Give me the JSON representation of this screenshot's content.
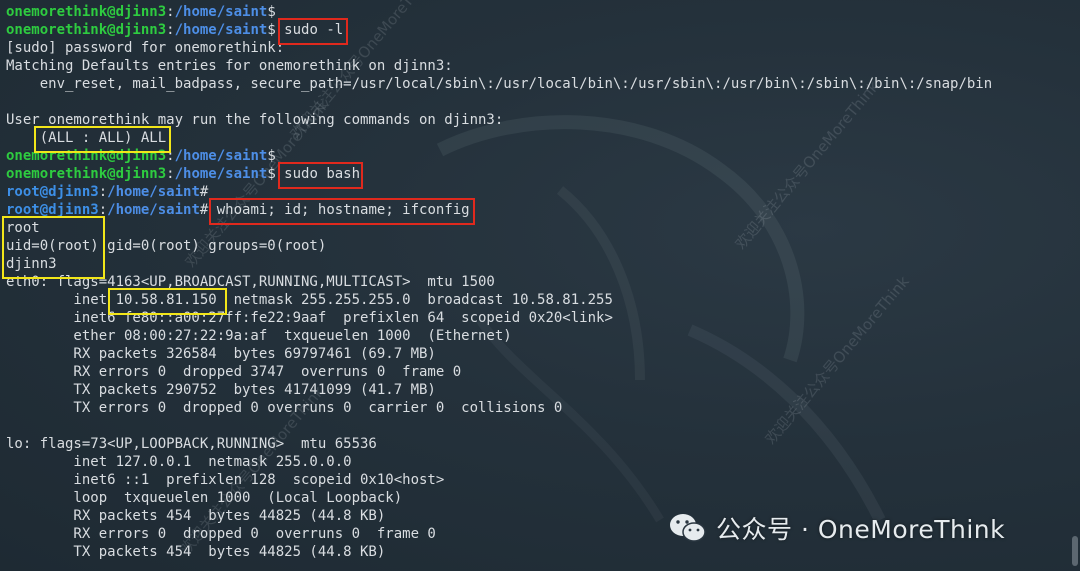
{
  "terminal": {
    "lines": [
      {
        "type": "prompt",
        "user": "onemorethink@djinn3",
        "path": "/home/saint",
        "symbol": "$",
        "cmd": ""
      },
      {
        "type": "prompt",
        "user": "onemorethink@djinn3",
        "path": "/home/saint",
        "symbol": "$",
        "cmd": " sudo -l"
      },
      {
        "type": "text",
        "text": "[sudo] password for onemorethink:"
      },
      {
        "type": "text",
        "text": "Matching Defaults entries for onemorethink on djinn3:"
      },
      {
        "type": "text",
        "text": "    env_reset, mail_badpass, secure_path=/usr/local/sbin\\:/usr/local/bin\\:/usr/sbin\\:/usr/bin\\:/sbin\\:/bin\\:/snap/bin"
      },
      {
        "type": "text",
        "text": ""
      },
      {
        "type": "text",
        "text": "User onemorethink may run the following commands on djinn3:"
      },
      {
        "type": "text",
        "text": "    (ALL : ALL) ALL"
      },
      {
        "type": "prompt",
        "user": "onemorethink@djinn3",
        "path": "/home/saint",
        "symbol": "$",
        "cmd": ""
      },
      {
        "type": "prompt",
        "user": "onemorethink@djinn3",
        "path": "/home/saint",
        "symbol": "$",
        "cmd": " sudo bash"
      },
      {
        "type": "rootprompt",
        "user": "root@djinn3",
        "path": "/home/saint",
        "symbol": "#",
        "cmd": ""
      },
      {
        "type": "rootprompt",
        "user": "root@djinn3",
        "path": "/home/saint",
        "symbol": "#",
        "cmd": " whoami; id; hostname; ifconfig"
      },
      {
        "type": "text",
        "text": "root"
      },
      {
        "type": "text",
        "text": "uid=0(root) gid=0(root) groups=0(root)"
      },
      {
        "type": "text",
        "text": "djinn3"
      },
      {
        "type": "text",
        "text": "eth0: flags=4163<UP,BROADCAST,RUNNING,MULTICAST>  mtu 1500"
      },
      {
        "type": "text",
        "text": "        inet 10.58.81.150  netmask 255.255.255.0  broadcast 10.58.81.255"
      },
      {
        "type": "text",
        "text": "        inet6 fe80::a00:27ff:fe22:9aaf  prefixlen 64  scopeid 0x20<link>"
      },
      {
        "type": "text",
        "text": "        ether 08:00:27:22:9a:af  txqueuelen 1000  (Ethernet)"
      },
      {
        "type": "text",
        "text": "        RX packets 326584  bytes 69797461 (69.7 MB)"
      },
      {
        "type": "text",
        "text": "        RX errors 0  dropped 3747  overruns 0  frame 0"
      },
      {
        "type": "text",
        "text": "        TX packets 290752  bytes 41741099 (41.7 MB)"
      },
      {
        "type": "text",
        "text": "        TX errors 0  dropped 0 overruns 0  carrier 0  collisions 0"
      },
      {
        "type": "text",
        "text": ""
      },
      {
        "type": "text",
        "text": "lo: flags=73<UP,LOOPBACK,RUNNING>  mtu 65536"
      },
      {
        "type": "text",
        "text": "        inet 127.0.0.1  netmask 255.0.0.0"
      },
      {
        "type": "text",
        "text": "        inet6 ::1  prefixlen 128  scopeid 0x10<host>"
      },
      {
        "type": "text",
        "text": "        loop  txqueuelen 1000  (Local Loopback)"
      },
      {
        "type": "text",
        "text": "        RX packets 454  bytes 44825 (44.8 KB)"
      },
      {
        "type": "text",
        "text": "        RX errors 0  dropped 0  overruns 0  frame 0"
      },
      {
        "type": "text",
        "text": "        TX packets 454  bytes 44825 (44.8 KB)"
      }
    ]
  },
  "watermark": {
    "diagonal_text": "欢迎关注公众号OneMoreThink",
    "wechat_label": "公众号 · OneMoreThink",
    "icon": "wechat-icon"
  },
  "colors": {
    "background": "#23303a",
    "user_prompt": "#2ecc40",
    "root_prompt": "#3d8fe6",
    "path": "#4d8ee6",
    "text": "#d9dde1",
    "highlight_red": "#e0291d",
    "highlight_yellow": "#f2e619"
  }
}
